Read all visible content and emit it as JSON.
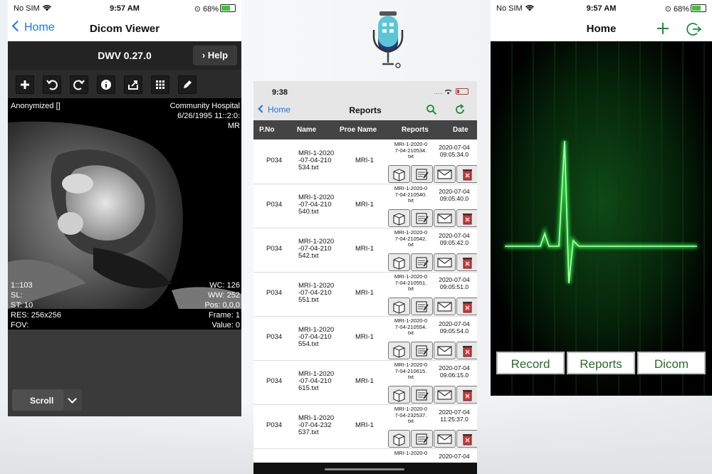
{
  "p1": {
    "status": {
      "carrier": "No SIM",
      "time": "9:57 AM",
      "battery": "68%"
    },
    "nav": {
      "back": "Home",
      "title": "Dicom Viewer"
    },
    "dwv": {
      "title": "DWV 0.27.0",
      "help": "Help"
    },
    "tools": [
      "plus-icon",
      "undo-icon",
      "redo-icon",
      "info-icon",
      "share-icon",
      "grid-icon",
      "pencil-icon"
    ],
    "overlay": {
      "tl": "Anonymized []",
      "tr1": "Community Hospital",
      "tr2": "6/26/1995 11::2:0:",
      "tr3": "MR",
      "bl": [
        "1::103",
        "SL:",
        "ST: 10",
        "RES: 256x256",
        "FOV:"
      ],
      "br": [
        "WC: 126",
        "WW: 252",
        "Pos: 0,0,0",
        "Frame: 1",
        "Value: 0"
      ]
    },
    "scroll": "Scroll"
  },
  "p2": {
    "status": {
      "time": "9:38",
      "signal": "....."
    },
    "nav": {
      "back": "Home",
      "title": "Reports"
    },
    "columns": [
      "P.No",
      "Name",
      "Proe Name",
      "Reports",
      "Date"
    ],
    "rows": [
      {
        "pno": "P034",
        "name": [
          "MRI-1-2020",
          "-07-04-210",
          "534.txt"
        ],
        "proe": "MRI-1",
        "report": [
          "MRI-1-2020-0",
          "7-04-210534.",
          "txt"
        ],
        "date": [
          "2020-07-04",
          "09:05:34.0"
        ]
      },
      {
        "pno": "P034",
        "name": [
          "MRI-1-2020",
          "-07-04-210",
          "540.txt"
        ],
        "proe": "MRI-1",
        "report": [
          "MRI-1-2020-0",
          "7-04-210540.",
          "txt"
        ],
        "date": [
          "2020-07-04",
          "09:05:40.0"
        ]
      },
      {
        "pno": "P034",
        "name": [
          "MRI-1-2020",
          "-07-04-210",
          "542.txt"
        ],
        "proe": "MRI-1",
        "report": [
          "MRI-1-2020-0",
          "7-04-210542.",
          "txt"
        ],
        "date": [
          "2020-07-04",
          "09:05:42.0"
        ]
      },
      {
        "pno": "P034",
        "name": [
          "MRI-1-2020",
          "-07-04-210",
          "551.txt"
        ],
        "proe": "MRI-1",
        "report": [
          "MRI-1-2020-0",
          "7-04-210551.",
          "txt"
        ],
        "date": [
          "2020-07-04",
          "09:05:51.0"
        ]
      },
      {
        "pno": "P034",
        "name": [
          "MRI-1-2020",
          "-07-04-210",
          "554.txt"
        ],
        "proe": "MRI-1",
        "report": [
          "MRI-1-2020-0",
          "7-04-210554.",
          "txt"
        ],
        "date": [
          "2020-07-04",
          "09:05:54.0"
        ]
      },
      {
        "pno": "P034",
        "name": [
          "MRI-1-2020",
          "-07-04-210",
          "615.txt"
        ],
        "proe": "MRI-1",
        "report": [
          "MRI-1-2020-0",
          "7-04-210615.",
          "txt"
        ],
        "date": [
          "2020-07-04",
          "09:06:15.0"
        ]
      },
      {
        "pno": "P034",
        "name": [
          "MRI-1-2020",
          "-07-04-232",
          "537.txt"
        ],
        "proe": "MRI-1",
        "report": [
          "MRI-1-2020-0",
          "7-04-232537.",
          "txt"
        ],
        "date": [
          "2020-07-04",
          "11:25:37.0"
        ]
      },
      {
        "pno": "",
        "name": [
          "",
          "",
          ""
        ],
        "proe": "",
        "report": [
          "MRI-1-2020-0",
          "",
          ""
        ],
        "date": [
          "2020-07-04",
          ""
        ]
      }
    ],
    "actions": [
      "box-icon",
      "edit-icon",
      "mail-icon",
      "trash-icon"
    ]
  },
  "p3": {
    "status": {
      "carrier": "No SIM",
      "time": "9:57 AM",
      "battery": "68%"
    },
    "nav": {
      "title": "Home"
    },
    "buttons": [
      "Record",
      "Reports",
      "Dicom"
    ]
  },
  "colors": {
    "ios_blue": "#1a73e8",
    "pulse_green": "#2dff4a",
    "dark_bg": "#2b2b2b"
  }
}
